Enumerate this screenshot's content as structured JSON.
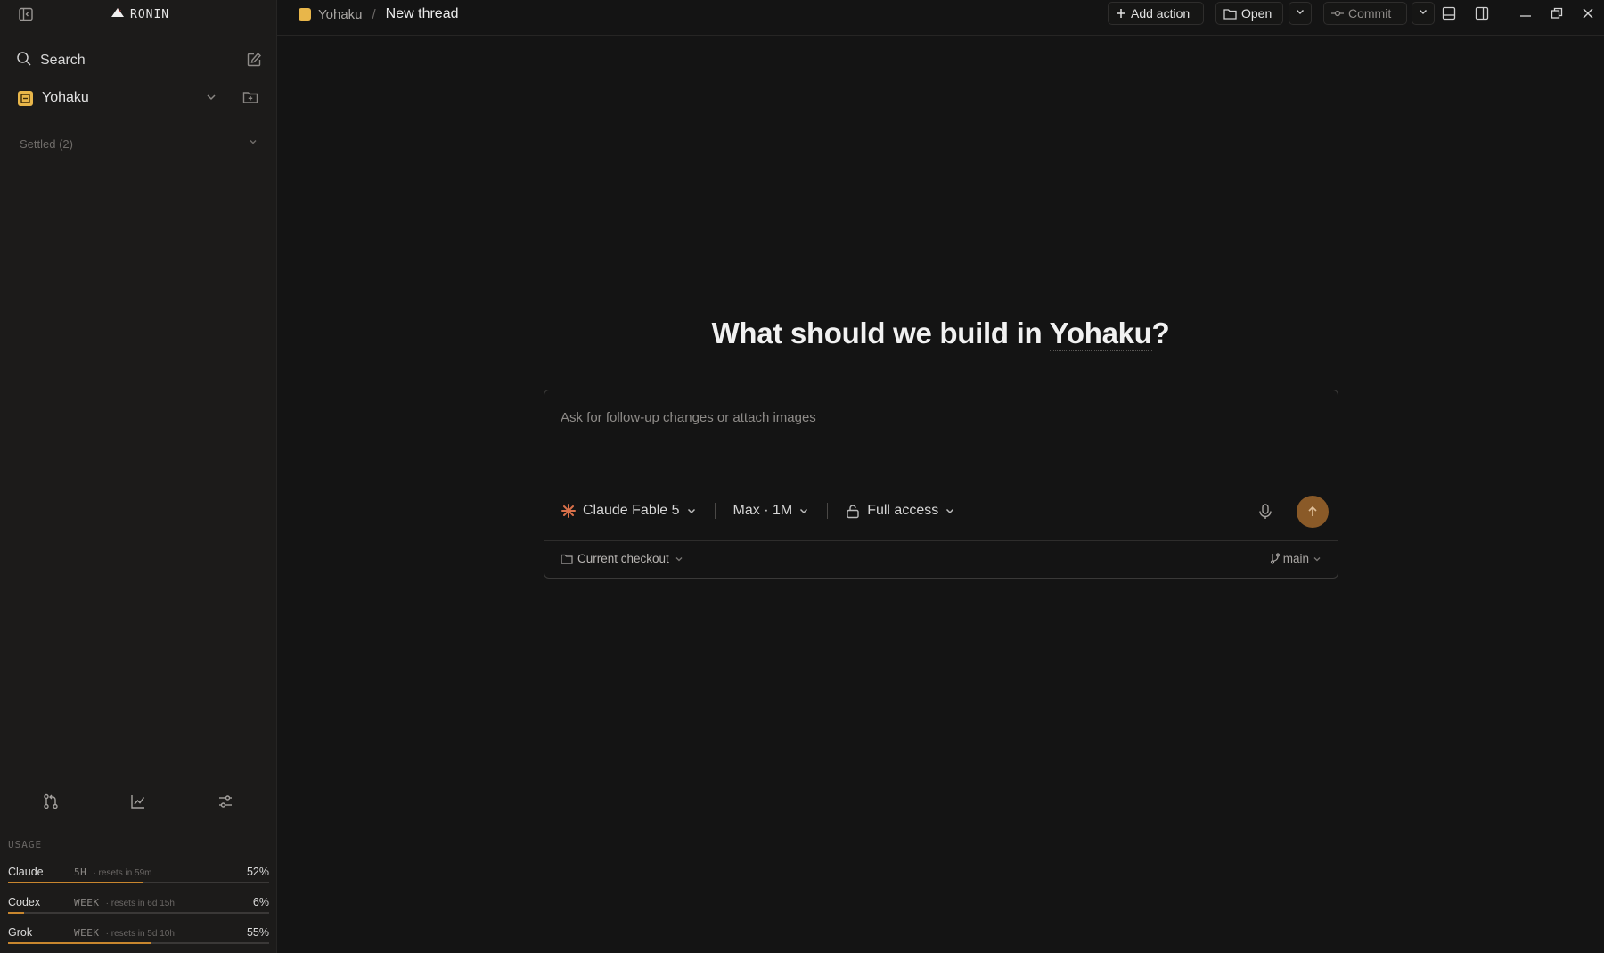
{
  "app": {
    "brand": "RONIN"
  },
  "sidebar": {
    "search_label": "Search",
    "project": {
      "name": "Yohaku"
    },
    "section": {
      "label": "Settled (2)"
    },
    "usage": {
      "title": "USAGE",
      "rows": [
        {
          "name": "Claude",
          "window": "5H",
          "reset": "· resets in 59m",
          "percent": "52%",
          "fill": 0.52
        },
        {
          "name": "Codex",
          "window": "WEEK",
          "reset": "· resets in 6d 15h",
          "percent": "6%",
          "fill": 0.06
        },
        {
          "name": "Grok",
          "window": "WEEK",
          "reset": "· resets in 5d 10h",
          "percent": "55%",
          "fill": 0.55
        }
      ]
    }
  },
  "header": {
    "breadcrumb_project": "Yohaku",
    "breadcrumb_sep": "/",
    "title": "New thread",
    "add_action_label": "Add action",
    "open_label": "Open",
    "commit_label": "Commit"
  },
  "main": {
    "heading_prefix": "What should we build in ",
    "heading_project": "Yohaku",
    "heading_suffix": "?",
    "composer": {
      "placeholder": "Ask for follow-up changes or attach images",
      "model": "Claude Fable 5",
      "effort": "Max · 1M",
      "access": "Full access",
      "checkout": "Current checkout",
      "branch": "main"
    }
  },
  "colors": {
    "accent": "#c8862e",
    "send_button": "#8a5a28",
    "project_badge": "#e8b64a"
  }
}
